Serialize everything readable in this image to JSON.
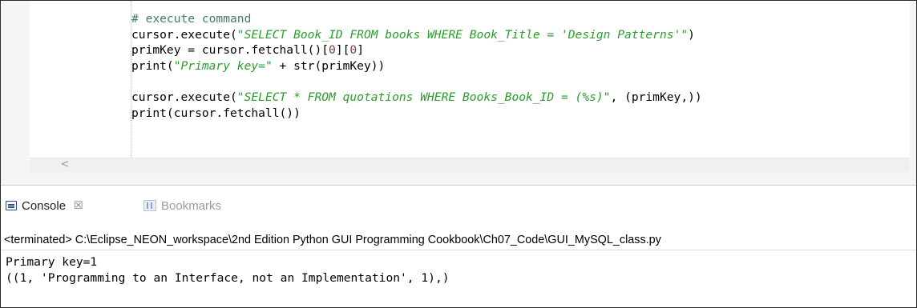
{
  "editor": {
    "code_lines": [
      {
        "parts": [
          {
            "t": "# execute command",
            "k": "c-com"
          }
        ]
      },
      {
        "parts": [
          {
            "t": "cursor.execute(",
            "k": ""
          },
          {
            "t": "\"SELECT Book_ID FROM books WHERE Book_Title = 'Design Patterns'\"",
            "k": "c-str"
          },
          {
            "t": ")",
            "k": ""
          }
        ]
      },
      {
        "parts": [
          {
            "t": "primKey = cursor.fetchall()[",
            "k": ""
          },
          {
            "t": "0",
            "k": "c-num"
          },
          {
            "t": "][",
            "k": ""
          },
          {
            "t": "0",
            "k": "c-num"
          },
          {
            "t": "]",
            "k": ""
          }
        ]
      },
      {
        "parts": [
          {
            "t": "print(",
            "k": ""
          },
          {
            "t": "\"Primary key=\"",
            "k": "c-str"
          },
          {
            "t": " + str(primKey))",
            "k": ""
          }
        ]
      },
      {
        "blank": true
      },
      {
        "parts": [
          {
            "t": "cursor.execute(",
            "k": ""
          },
          {
            "t": "\"SELECT * FROM quotations WHERE Books_Book_ID = (%s)\"",
            "k": "c-str"
          },
          {
            "t": ", (primKey,))",
            "k": ""
          }
        ]
      },
      {
        "parts": [
          {
            "t": "print(cursor.fetchall())",
            "k": ""
          }
        ]
      }
    ],
    "scroll_left_glyph": "<"
  },
  "console": {
    "tabs": {
      "console_label": "Console",
      "close_glyph": "☒",
      "bookmarks_label": "Bookmarks"
    },
    "status_line": "<terminated> C:\\Eclipse_NEON_workspace\\2nd Edition Python GUI Programming Cookbook\\Ch07_Code\\GUI_MySQL_class.py",
    "output_lines": [
      "Primary key=1",
      "((1, 'Programming to an Interface, not an Implementation', 1),)"
    ]
  }
}
